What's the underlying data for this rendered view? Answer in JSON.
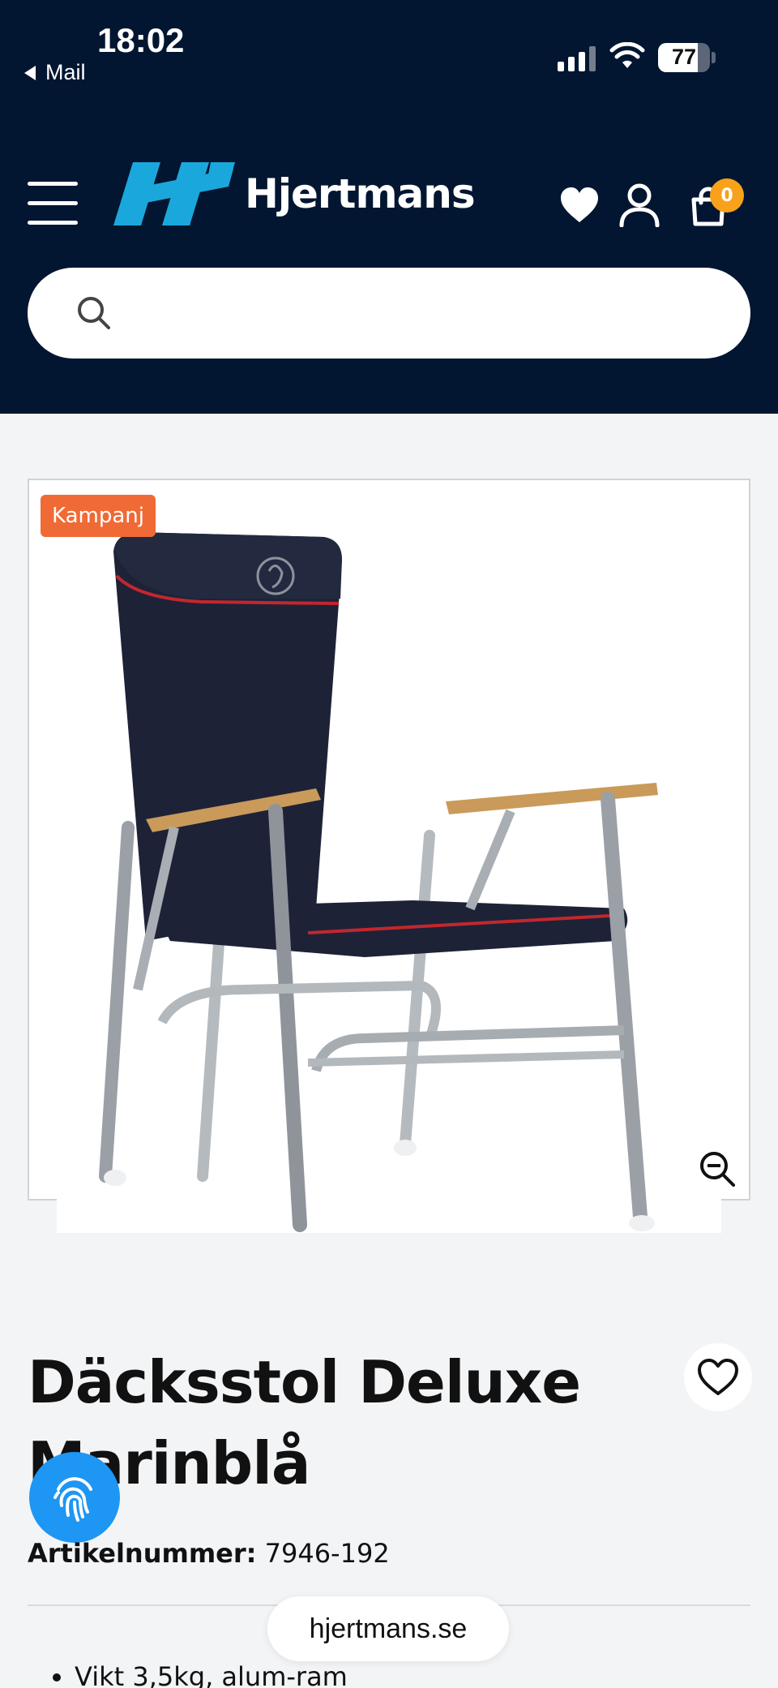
{
  "status_bar": {
    "time": "18:02",
    "back_app": "Mail",
    "battery": "77",
    "battery_level": 0.77
  },
  "header": {
    "brand": "Hjertmans",
    "cart_count": "0"
  },
  "search": {
    "placeholder": ""
  },
  "product": {
    "badge": "Kampanj",
    "title": "Däcksstol Deluxe Marinblå",
    "sku_label": "Artikelnummer:",
    "sku_value": "7946-192",
    "bullets": [
      "Vikt 3,5kg, alum-ram"
    ]
  },
  "browser": {
    "url": "hjertmans.se"
  },
  "colors": {
    "header_bg": "#021631",
    "accent_blue": "#1aa8dc",
    "badge_orange": "#f06a35",
    "cart_badge": "#f7a21a"
  }
}
